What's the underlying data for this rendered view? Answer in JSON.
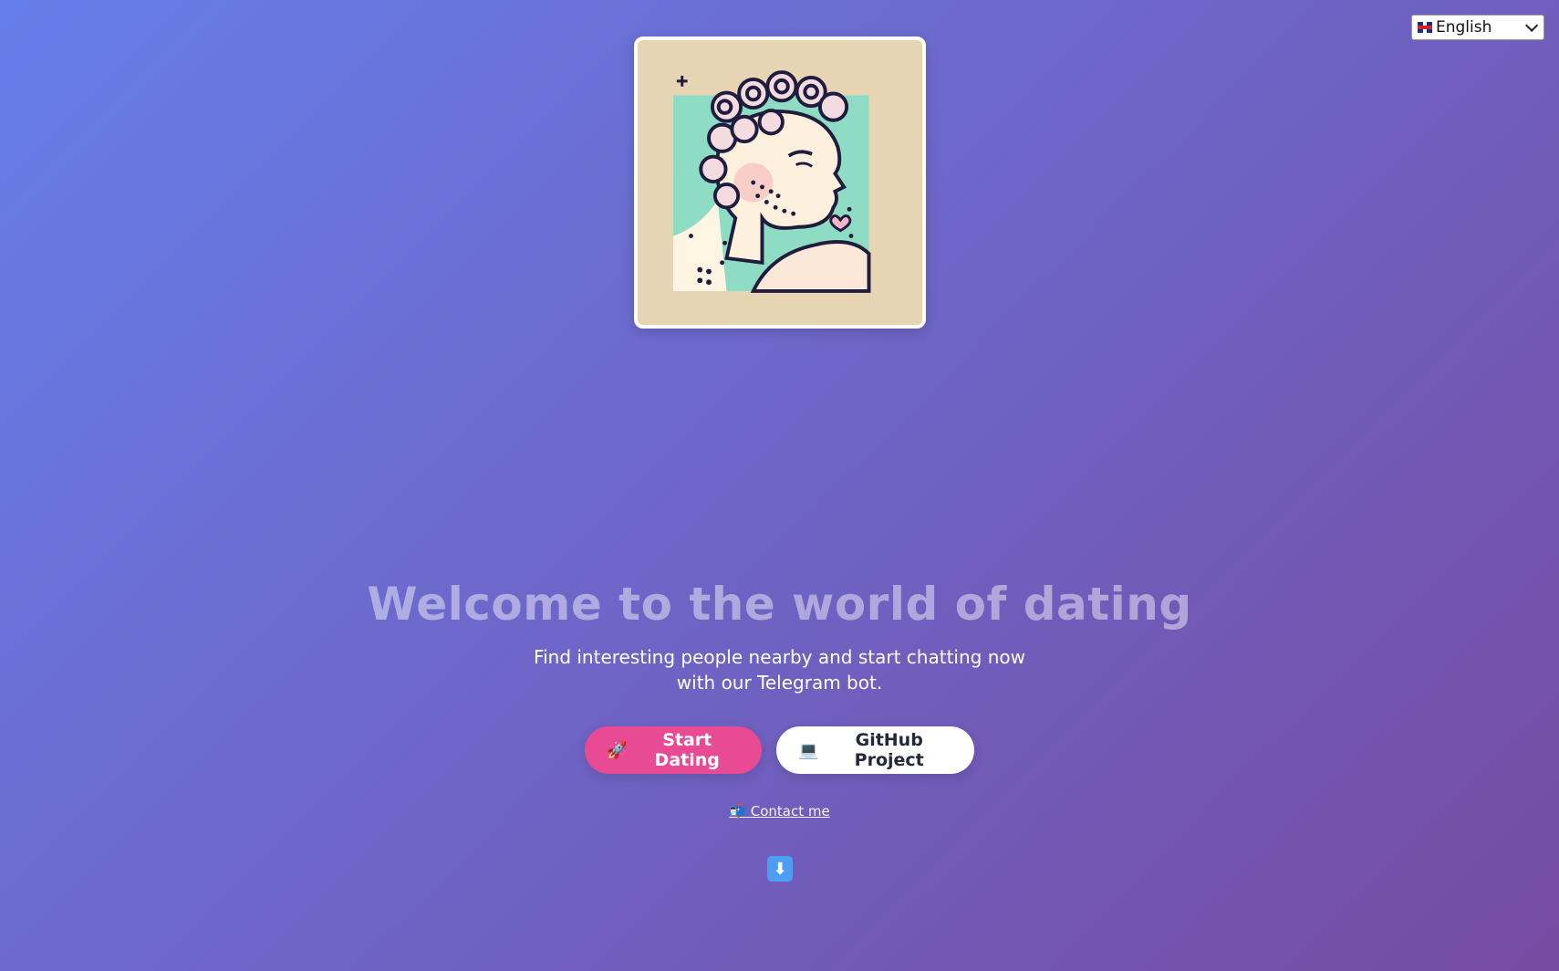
{
  "language_selector": {
    "selected": "English",
    "flag_icon": "uk-flag-icon"
  },
  "hero": {
    "title": "Welcome to the world of dating",
    "subtitle": "Find interesting people nearby and start chatting now with our Telegram bot."
  },
  "buttons": {
    "start_dating": {
      "emoji": "🚀",
      "label": "Start Dating",
      "icon": "rocket-icon",
      "color": "#e84a93"
    },
    "github_project": {
      "emoji": "💻",
      "label": "GitHub Project",
      "icon": "laptop-icon",
      "color": "#ffffff"
    }
  },
  "contact": {
    "emoji": "📬",
    "label": "Contact me",
    "icon": "mailbox-icon"
  },
  "scroll_down": {
    "glyph": "⬇",
    "icon": "down-arrow-icon",
    "color": "#4d9ef3"
  },
  "theme": {
    "gradient_start": "#667eea",
    "gradient_end": "#764ba2"
  }
}
